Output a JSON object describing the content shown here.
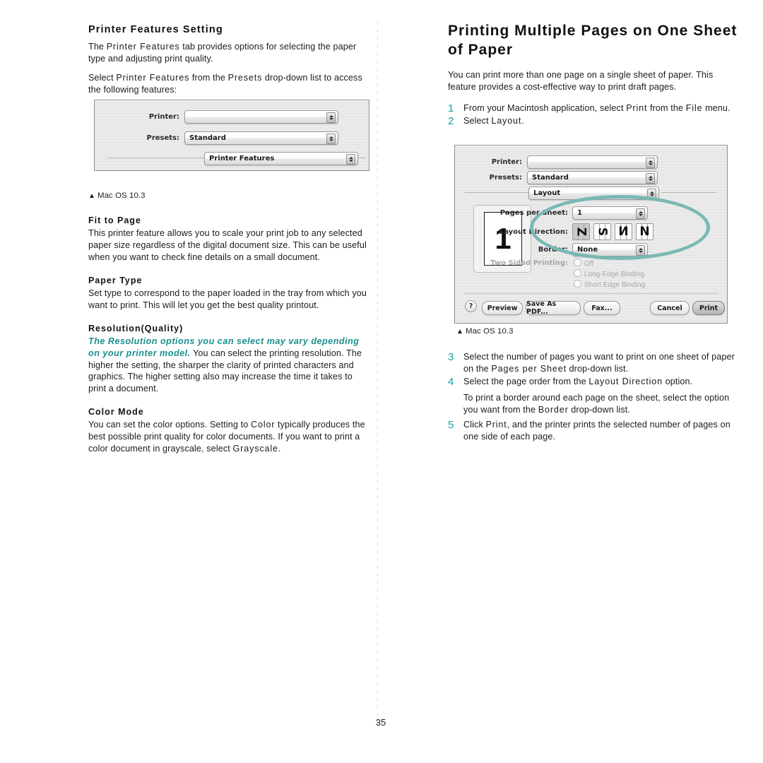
{
  "page": {
    "number": "35"
  },
  "left_column": {
    "section_title": "Printer Features Setting",
    "paragraphs": [
      "The Printer Features tab provides options for selecting the paper type and adjusting print quality.",
      "Select Printer Features from the Presets drop-down list to access the following features:"
    ],
    "p1_a": "The ",
    "p1_b": "Printer Features",
    "p1_c": " tab provides options for selecting the paper type and adjusting print quality.",
    "p2_a": "Select ",
    "p2_b": "Printer Features",
    "p2_c": " from the ",
    "p2_d": "Presets",
    "p2_e": " drop-down list to access the following features:",
    "caption": "Mac OS 10.3",
    "caption_triangle": "triangle-up-icon",
    "subsections": [
      {
        "heading": "Fit to Page",
        "text": "This printer feature allows you to scale your print job to any selected paper size regardless of the digital document size. This can be useful when you want to check fine details on a small document."
      },
      {
        "heading": "Paper Type",
        "text": "Set type to correspond to the paper loaded in the tray from which you want to print. This will let you get the best quality printout."
      },
      {
        "heading": "Resolution(Quality)",
        "note_italic": "The Resolution options you can select may vary depending on your printer model.",
        "text_after_note": " You can select the printing resolution. The higher the setting, the sharper the clarity of printed characters and graphics. The higher setting also may increase the time it takes to print a document."
      },
      {
        "heading": "Color Mode",
        "cm_a": "You can set the color options. Setting to ",
        "cm_b": "Color",
        "cm_c": " typically produces the best possible print quality for color documents. If you want to print a color document in grayscale, select ",
        "cm_d": "Grayscale",
        "cm_e": "."
      }
    ],
    "dialog": {
      "name": "mac-print-dialog-printer-features",
      "rows": [
        {
          "label": "Printer:",
          "value": ""
        },
        {
          "label": "Presets:",
          "value": "Standard"
        }
      ],
      "pane_popup_value": "Printer Features"
    }
  },
  "right_column": {
    "title": "Printing Multiple Pages on One Sheet of Paper",
    "intro": "You can print more than one page on a single sheet of paper. This feature provides a cost-effective way to print draft pages.",
    "steps_top": [
      {
        "num": "1",
        "a": "From your Macintosh application, select ",
        "b": "Print",
        "c": " from the ",
        "d": "File",
        "e": " menu."
      },
      {
        "num": "2",
        "a": "Select ",
        "b": "Layout",
        "c": ".",
        "d": "",
        "e": ""
      }
    ],
    "caption": "Mac OS 10.3",
    "caption_triangle": "triangle-up-icon",
    "steps_bottom": [
      {
        "num": "3",
        "a": "Select the number of pages you want to print on one sheet of paper on the ",
        "b": "Pages per Sheet",
        "c": " drop-down list.",
        "d": "",
        "e": ""
      },
      {
        "num": "4",
        "a": "Select the page order from the ",
        "b": "Layout Direction",
        "c": " option.",
        "d": "",
        "e": ""
      },
      {
        "num": "5",
        "a": "Click ",
        "b": "Print",
        "c": ", and the printer prints the selected number of pages on one side of each page.",
        "d": "",
        "e": ""
      }
    ],
    "note_unnumbered": {
      "a": "To print a border around each page on the sheet, select the option you want from the ",
      "b": "Border",
      "c": " drop-down list."
    },
    "dialog": {
      "name": "mac-print-dialog-layout",
      "rows": [
        {
          "label": "Printer:",
          "value": ""
        },
        {
          "label": "Presets:",
          "value": "Standard"
        }
      ],
      "pane_popup_value": "Layout",
      "preview_number": "1",
      "pages_per_sheet": {
        "label": "Pages per Sheet:",
        "value": "1"
      },
      "layout_direction": {
        "label": "Layout Direction:",
        "options": [
          "Z",
          "S",
          "И",
          "N"
        ],
        "selected_index": 0
      },
      "border": {
        "label": "Border:",
        "value": "None"
      },
      "two_sided": {
        "label": "Two Sided Printing:",
        "options": [
          "Off",
          "Long-Edge Binding",
          "Short Edge Binding"
        ]
      },
      "buttons": {
        "help": "?",
        "preview": "Preview",
        "save_as_pdf": "Save As PDF...",
        "fax": "Fax...",
        "cancel": "Cancel",
        "print": "Print"
      }
    }
  },
  "colors": {
    "teal_accent": "#18a0a0",
    "teal_highlight": "#7ab8b4",
    "dialog_bg": "#ebebeb"
  }
}
